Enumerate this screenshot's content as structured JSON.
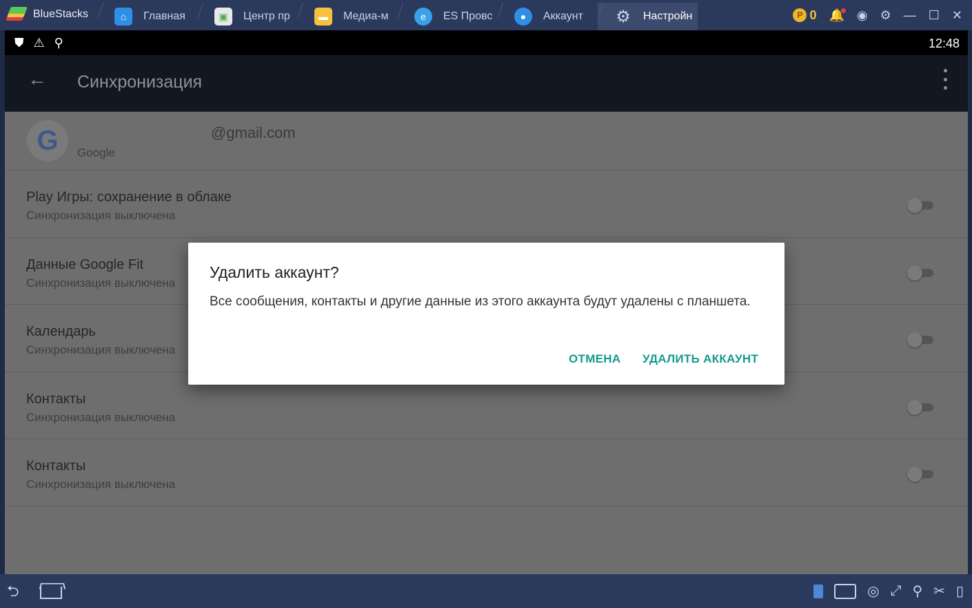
{
  "titlebar": {
    "app_name": "BlueStacks",
    "tabs": [
      {
        "label": "Главная",
        "icon": "home-icon",
        "color": "#2f8fe6",
        "active": false
      },
      {
        "label": "Центр пр",
        "icon": "app-center-icon",
        "color": "#e8e8e8",
        "active": false
      },
      {
        "label": "Медиа-м",
        "icon": "folder-icon",
        "color": "#f6c23e",
        "active": false
      },
      {
        "label": "ES Провс",
        "icon": "es-explorer-icon",
        "color": "#3aa0e8",
        "active": false
      },
      {
        "label": "Аккаунт",
        "icon": "account-icon",
        "color": "#2f8fe6",
        "active": false
      },
      {
        "label": "Настройн",
        "icon": "settings-icon",
        "color": "#9aa3b8",
        "active": true
      }
    ],
    "coins": "0"
  },
  "status_bar": {
    "time": "12:48"
  },
  "app_bar": {
    "title": "Синхронизация"
  },
  "account": {
    "email": "@gmail.com",
    "type": "Google"
  },
  "sync_items": [
    {
      "title": "Play Игры: сохранение в облаке",
      "subtitle": "Синхронизация выключена",
      "enabled": false
    },
    {
      "title": "Данные Google Fit",
      "subtitle": "Синхронизация выключена",
      "enabled": false
    },
    {
      "title": "Календарь",
      "subtitle": "Синхронизация выключена",
      "enabled": false
    },
    {
      "title": "Контакты",
      "subtitle": "Синхронизация выключена",
      "enabled": false
    },
    {
      "title": "Контакты",
      "subtitle": "Синхронизация выключена",
      "enabled": false
    }
  ],
  "dialog": {
    "title": "Удалить аккаунт?",
    "message": "Все сообщения, контакты и другие данные из этого аккаунта будут удалены с планшета.",
    "cancel_label": "ОТМЕНА",
    "confirm_label": "УДАЛИТЬ АККАУНТ"
  },
  "colors": {
    "accent": "#139b8e",
    "titlebar": "#2b3a5c",
    "appbar": "#131722"
  }
}
